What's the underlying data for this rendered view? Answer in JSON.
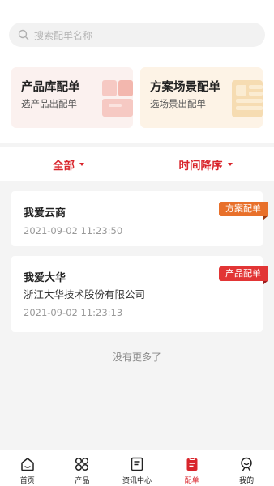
{
  "search": {
    "placeholder": "搜索配单名称"
  },
  "cards": [
    {
      "title": "产品库配单",
      "subtitle": "选产品出配单"
    },
    {
      "title": "方案场景配单",
      "subtitle": "选场景出配单"
    }
  ],
  "filters": [
    {
      "label": "全部"
    },
    {
      "label": "时间降序"
    }
  ],
  "orders": [
    {
      "name": "我爱云商",
      "company": "",
      "time": "2021-09-02 11:23:50",
      "tag": "方案配单"
    },
    {
      "name": "我爱大华",
      "company": "浙江大华技术股份有限公司",
      "time": "2021-09-02 11:23:13",
      "tag": "产品配单"
    }
  ],
  "no_more": "没有更多了",
  "tabbar": [
    {
      "label": "首页",
      "icon": "home-icon"
    },
    {
      "label": "产品",
      "icon": "grid-icon"
    },
    {
      "label": "资讯中心",
      "icon": "news-icon"
    },
    {
      "label": "配单",
      "icon": "order-icon",
      "active": true
    },
    {
      "label": "我的",
      "icon": "profile-icon"
    }
  ],
  "colors": {
    "accent": "#d9252c",
    "tag_scheme": "#e8702a",
    "tag_product": "#e23535"
  }
}
